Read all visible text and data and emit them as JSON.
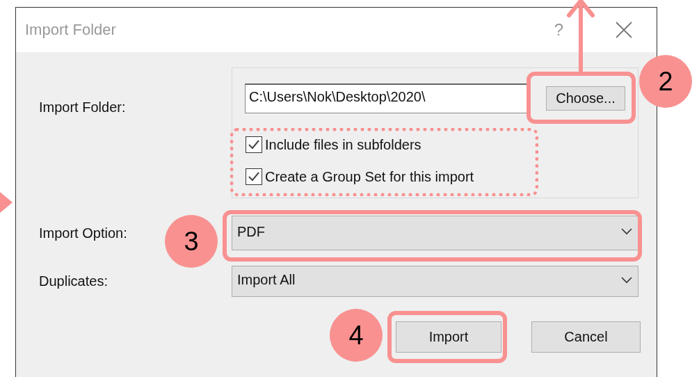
{
  "window": {
    "title": "Import Folder",
    "help": "?"
  },
  "folder": {
    "label": "Import Folder:",
    "path": "C:\\Users\\Nok\\Desktop\\2020\\",
    "choose_button": "Choose..."
  },
  "options": [
    {
      "label": "Include files in subfolders",
      "checked": true
    },
    {
      "label": "Create a Group Set for this import",
      "checked": true
    }
  ],
  "import_option": {
    "label": "Import Option:",
    "value": "PDF"
  },
  "duplicates": {
    "label": "Duplicates:",
    "value": "Import All"
  },
  "buttons": [
    {
      "label": "Import"
    },
    {
      "label": "Cancel"
    }
  ],
  "callouts": [
    "2",
    "3",
    "4"
  ]
}
